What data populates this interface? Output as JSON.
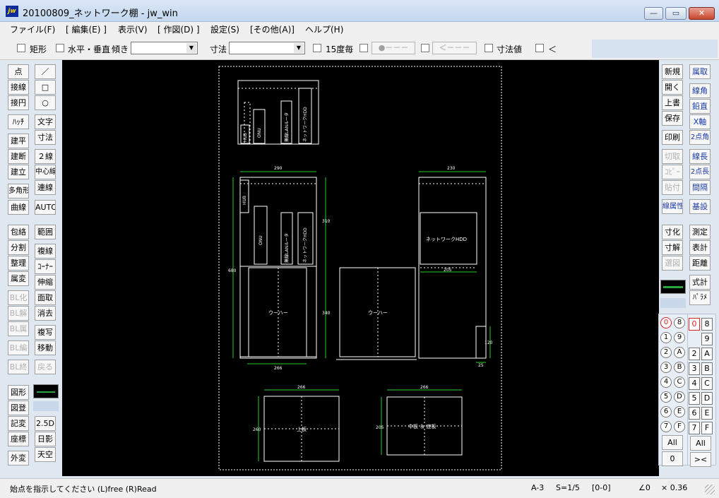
{
  "window": {
    "title": "20100809_ネットワーク棚 - jw_win",
    "icon": "jw",
    "min": "—",
    "max": "▭",
    "close": "✕"
  },
  "menu": [
    "ファイル(F)",
    "[ 編集(E) ]",
    "表示(V)",
    "[ 作図(D) ]",
    "設定(S)",
    "[その他(A)]",
    "ヘルプ(H)"
  ],
  "toolbar": {
    "rect_label": "矩形",
    "hv_label": "水平・垂直",
    "slope_label": "傾き",
    "dim_label": "寸法",
    "deg15_label": "15度毎",
    "point_btn": "●－－－",
    "arrow_btn": "＜－－－",
    "dimval_label": "寸法値",
    "lt_label": "＜"
  },
  "left_tools": {
    "col1": [
      "点",
      "接線",
      "接円",
      "ﾊｯﾁ",
      "建平",
      "建断",
      "建立",
      "多角形",
      "曲線",
      "包絡",
      "分割",
      "整理",
      "属変",
      "BL化",
      "BL解",
      "BL属",
      "BL編",
      "BL終",
      "図形",
      "図登",
      "記変",
      "座標",
      "外変"
    ],
    "col2": [
      "／",
      "□",
      "○",
      "文字",
      "寸法",
      "２線",
      "中心線",
      "連線",
      "AUTO",
      "範囲",
      "複線",
      "ｺｰﾅｰ",
      "伸縮",
      "面取",
      "消去",
      "複写",
      "移動",
      "戻る",
      "2.5D",
      "日影",
      "天空"
    ]
  },
  "right_tools": {
    "col1": [
      "新規",
      "開く",
      "上書",
      "保存",
      "印刷",
      "切取",
      "ｺﾋﾟｰ",
      "貼付",
      "線属性",
      "寸化",
      "寸解",
      "選図"
    ],
    "col2": [
      "属取",
      "線角",
      "鉛直",
      "X軸",
      "2点角",
      "線長",
      "2点長",
      "間隔",
      "基設",
      "測定",
      "表計",
      "距離",
      "式計",
      "ﾊﾟﾗﾒ"
    ]
  },
  "layer_groups": [
    "0",
    "1",
    "2",
    "3",
    "4",
    "5",
    "6",
    "7",
    "8",
    "9",
    "A",
    "B",
    "C",
    "D",
    "E",
    "F"
  ],
  "layer_group_symbols": [
    "⓪",
    "①",
    "②",
    "③",
    "④",
    "⑤",
    "⑥",
    "⑦",
    "⑧",
    "⑨",
    "Ⓐ",
    "Ⓑ",
    "Ⓒ",
    "Ⓓ",
    "Ⓔ",
    "Ⓕ"
  ],
  "layer_all": "All",
  "layer_zero": "0",
  "layer_x": "><",
  "drawing": {
    "labels": {
      "hub": "HUB",
      "onu": "ONU",
      "router": "無線LANルータ",
      "nas": "ネットワークHDD",
      "woofer": "ウーハー",
      "nas_front": "ネットワークHDD",
      "top_board": "上板",
      "mid_board": "中板 ＆ 底板"
    },
    "dims": {
      "w290": "290",
      "w230": "230",
      "h680": "680",
      "h310": "310",
      "h340": "340",
      "w266": "266",
      "w205": "205",
      "h120": "120",
      "w25": "25",
      "w266b": "266",
      "h260": "260",
      "w266c": "266",
      "h205": "205"
    }
  },
  "status": {
    "prompt": "始点を指示してください (L)free (R)Read",
    "paper": "A-3",
    "scale": "S=1/5",
    "layer": "[0-0]",
    "angle": "∠0",
    "zoom": "× 0.36"
  }
}
